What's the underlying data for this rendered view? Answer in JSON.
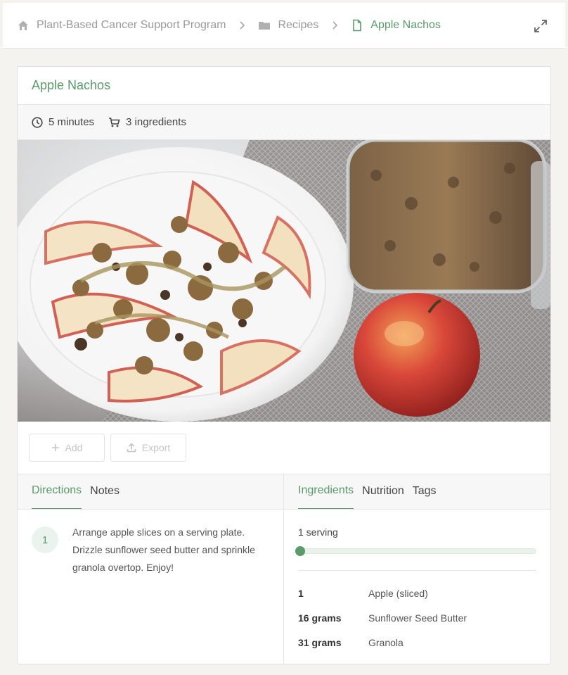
{
  "breadcrumb": {
    "items": [
      {
        "label": "Plant-Based Cancer Support Program",
        "icon": "home-icon"
      },
      {
        "label": "Recipes",
        "icon": "folder-icon"
      },
      {
        "label": "Apple Nachos",
        "icon": "document-icon"
      }
    ]
  },
  "recipe": {
    "title": "Apple Nachos",
    "time": "5 minutes",
    "ingredient_count": "3 ingredients"
  },
  "actions": {
    "add_label": "Add",
    "export_label": "Export"
  },
  "left_tabs": [
    {
      "label": "Directions",
      "active": true
    },
    {
      "label": "Notes",
      "active": false
    }
  ],
  "right_tabs": [
    {
      "label": "Ingredients",
      "active": true
    },
    {
      "label": "Nutrition",
      "active": false
    },
    {
      "label": "Tags",
      "active": false
    }
  ],
  "directions": [
    {
      "number": "1",
      "text": "Arrange apple slices on a serving plate. Drizzle sunflower seed butter and sprinkle granola overtop. Enjoy!"
    }
  ],
  "serving": {
    "label": "1 serving",
    "slider_fraction": 0.0
  },
  "ingredients": [
    {
      "qty": "1",
      "name": "Apple (sliced)"
    },
    {
      "qty": "16 grams",
      "name": "Sunflower Seed Butter"
    },
    {
      "qty": "31 grams",
      "name": "Granola"
    }
  ],
  "colors": {
    "accent": "#5a9a6b",
    "muted": "#9a9a9a"
  }
}
